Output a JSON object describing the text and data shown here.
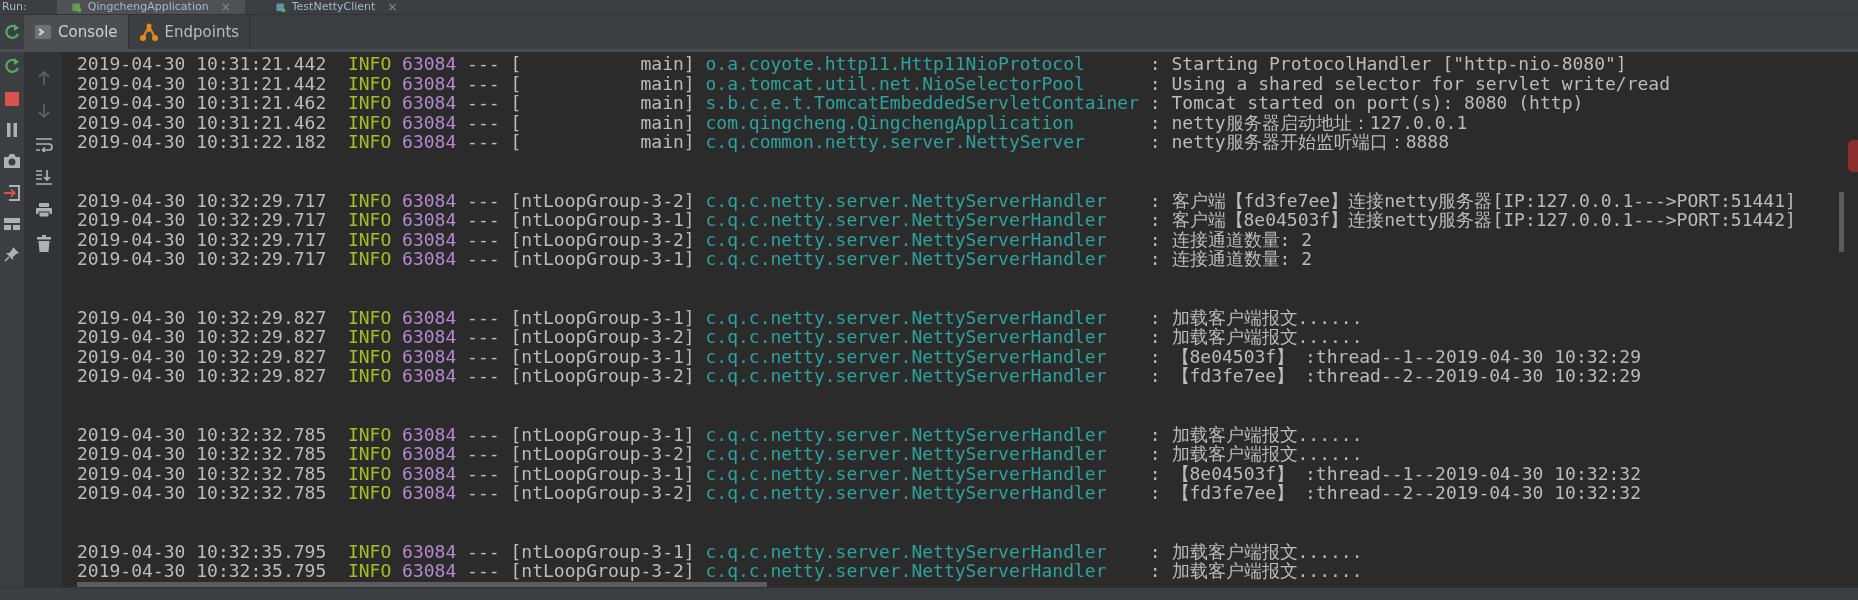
{
  "run_bar": {
    "label": "Run:",
    "tabs": [
      {
        "label": "QingchengApplication",
        "close": "×",
        "selected": true
      },
      {
        "label": "TestNettyClient",
        "close": "×",
        "selected": false
      }
    ]
  },
  "console_tabs": [
    {
      "label": "Console",
      "kind": "console",
      "selected": true
    },
    {
      "label": "Endpoints",
      "kind": "endpoints",
      "selected": false
    }
  ],
  "side_tools": [
    {
      "kind": "rerun",
      "disabled": false
    },
    {
      "kind": "stop",
      "disabled": false
    },
    {
      "kind": "pause",
      "disabled": false
    },
    {
      "kind": "camera",
      "disabled": false
    },
    {
      "kind": "login",
      "disabled": false
    },
    {
      "kind": "layout",
      "disabled": false
    },
    {
      "kind": "pin",
      "disabled": false
    }
  ],
  "console_tools": [
    {
      "kind": "up",
      "disabled": true
    },
    {
      "kind": "down",
      "disabled": true
    },
    {
      "kind": "wrap",
      "disabled": false
    },
    {
      "kind": "scroll-end",
      "disabled": false
    },
    {
      "kind": "print",
      "disabled": false
    },
    {
      "kind": "trash",
      "disabled": false
    }
  ],
  "log_groups": [
    {
      "lines": [
        {
          "time": "2019-04-30 10:31:21.442",
          "level": "INFO",
          "pid": "63084",
          "sep": "---",
          "thread": "[           main]",
          "logger": "o.a.coyote.http11.Http11NioProtocol",
          "message": ": Starting ProtocolHandler [\"http-nio-8080\"]"
        },
        {
          "time": "2019-04-30 10:31:21.442",
          "level": "INFO",
          "pid": "63084",
          "sep": "---",
          "thread": "[           main]",
          "logger": "o.a.tomcat.util.net.NioSelectorPool",
          "message": ": Using a shared selector for servlet write/read"
        },
        {
          "time": "2019-04-30 10:31:21.462",
          "level": "INFO",
          "pid": "63084",
          "sep": "---",
          "thread": "[           main]",
          "logger": "s.b.c.e.t.TomcatEmbeddedServletContainer",
          "message": ": Tomcat started on port(s): 8080 (http)"
        },
        {
          "time": "2019-04-30 10:31:21.462",
          "level": "INFO",
          "pid": "63084",
          "sep": "---",
          "thread": "[           main]",
          "logger": "com.qingcheng.QingchengApplication",
          "message": ": netty服务器启动地址：127.0.0.1"
        },
        {
          "time": "2019-04-30 10:31:22.182",
          "level": "INFO",
          "pid": "63084",
          "sep": "---",
          "thread": "[           main]",
          "logger": "c.q.common.netty.server.NettyServer",
          "message": ": netty服务器开始监听端口：8888"
        }
      ]
    },
    {
      "lines": [
        {
          "time": "2019-04-30 10:32:29.717",
          "level": "INFO",
          "pid": "63084",
          "sep": "---",
          "thread": "[ntLoopGroup-3-2]",
          "logger": "c.q.c.netty.server.NettyServerHandler",
          "message": ": 客户端【fd3fe7ee】连接netty服务器[IP:127.0.0.1--->PORT:51441]"
        },
        {
          "time": "2019-04-30 10:32:29.717",
          "level": "INFO",
          "pid": "63084",
          "sep": "---",
          "thread": "[ntLoopGroup-3-1]",
          "logger": "c.q.c.netty.server.NettyServerHandler",
          "message": ": 客户端【8e04503f】连接netty服务器[IP:127.0.0.1--->PORT:51442]"
        },
        {
          "time": "2019-04-30 10:32:29.717",
          "level": "INFO",
          "pid": "63084",
          "sep": "---",
          "thread": "[ntLoopGroup-3-2]",
          "logger": "c.q.c.netty.server.NettyServerHandler",
          "message": ": 连接通道数量: 2"
        },
        {
          "time": "2019-04-30 10:32:29.717",
          "level": "INFO",
          "pid": "63084",
          "sep": "---",
          "thread": "[ntLoopGroup-3-1]",
          "logger": "c.q.c.netty.server.NettyServerHandler",
          "message": ": 连接通道数量: 2"
        }
      ]
    },
    {
      "lines": [
        {
          "time": "2019-04-30 10:32:29.827",
          "level": "INFO",
          "pid": "63084",
          "sep": "---",
          "thread": "[ntLoopGroup-3-1]",
          "logger": "c.q.c.netty.server.NettyServerHandler",
          "message": ": 加载客户端报文......"
        },
        {
          "time": "2019-04-30 10:32:29.827",
          "level": "INFO",
          "pid": "63084",
          "sep": "---",
          "thread": "[ntLoopGroup-3-2]",
          "logger": "c.q.c.netty.server.NettyServerHandler",
          "message": ": 加载客户端报文......"
        },
        {
          "time": "2019-04-30 10:32:29.827",
          "level": "INFO",
          "pid": "63084",
          "sep": "---",
          "thread": "[ntLoopGroup-3-1]",
          "logger": "c.q.c.netty.server.NettyServerHandler",
          "message": ": 【8e04503f】 :thread--1--2019-04-30 10:32:29"
        },
        {
          "time": "2019-04-30 10:32:29.827",
          "level": "INFO",
          "pid": "63084",
          "sep": "---",
          "thread": "[ntLoopGroup-3-2]",
          "logger": "c.q.c.netty.server.NettyServerHandler",
          "message": ": 【fd3fe7ee】 :thread--2--2019-04-30 10:32:29"
        }
      ]
    },
    {
      "lines": [
        {
          "time": "2019-04-30 10:32:32.785",
          "level": "INFO",
          "pid": "63084",
          "sep": "---",
          "thread": "[ntLoopGroup-3-1]",
          "logger": "c.q.c.netty.server.NettyServerHandler",
          "message": ": 加载客户端报文......"
        },
        {
          "time": "2019-04-30 10:32:32.785",
          "level": "INFO",
          "pid": "63084",
          "sep": "---",
          "thread": "[ntLoopGroup-3-2]",
          "logger": "c.q.c.netty.server.NettyServerHandler",
          "message": ": 加载客户端报文......"
        },
        {
          "time": "2019-04-30 10:32:32.785",
          "level": "INFO",
          "pid": "63084",
          "sep": "---",
          "thread": "[ntLoopGroup-3-1]",
          "logger": "c.q.c.netty.server.NettyServerHandler",
          "message": ": 【8e04503f】 :thread--1--2019-04-30 10:32:32"
        },
        {
          "time": "2019-04-30 10:32:32.785",
          "level": "INFO",
          "pid": "63084",
          "sep": "---",
          "thread": "[ntLoopGroup-3-2]",
          "logger": "c.q.c.netty.server.NettyServerHandler",
          "message": ": 【fd3fe7ee】 :thread--2--2019-04-30 10:32:32"
        }
      ]
    },
    {
      "lines": [
        {
          "time": "2019-04-30 10:32:35.795",
          "level": "INFO",
          "pid": "63084",
          "sep": "---",
          "thread": "[ntLoopGroup-3-1]",
          "logger": "c.q.c.netty.server.NettyServerHandler",
          "message": ": 加载客户端报文......"
        },
        {
          "time": "2019-04-30 10:32:35.795",
          "level": "INFO",
          "pid": "63084",
          "sep": "---",
          "thread": "[ntLoopGroup-3-2]",
          "logger": "c.q.c.netty.server.NettyServerHandler",
          "message": ": 加载客户端报文......"
        }
      ]
    }
  ]
}
